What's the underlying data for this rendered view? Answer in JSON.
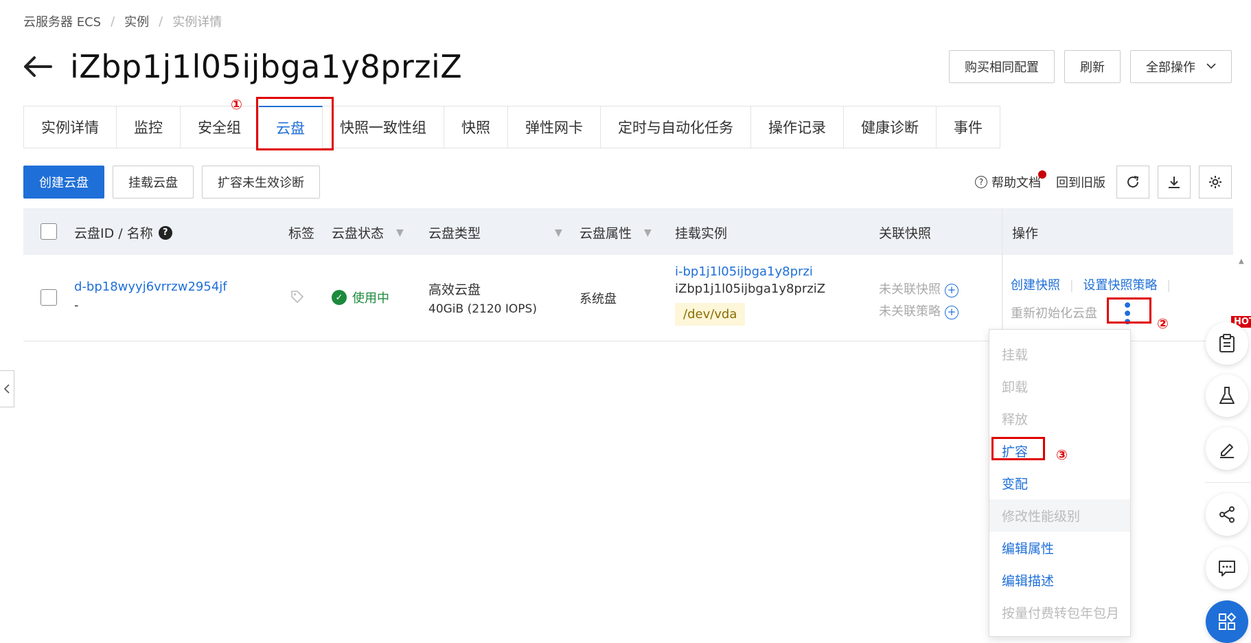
{
  "breadcrumb": {
    "items": [
      "云服务器 ECS",
      "实例",
      "实例详情"
    ],
    "separator": "/"
  },
  "page_title": "iZbp1j1l05ijbga1y8prziZ",
  "header_actions": {
    "buy_same": "购买相同配置",
    "refresh": "刷新",
    "all_ops": "全部操作"
  },
  "tabs": [
    {
      "label": "实例详情"
    },
    {
      "label": "监控"
    },
    {
      "label": "安全组"
    },
    {
      "label": "云盘",
      "active": true
    },
    {
      "label": "快照一致性组"
    },
    {
      "label": "快照"
    },
    {
      "label": "弹性网卡"
    },
    {
      "label": "定时与自动化任务"
    },
    {
      "label": "操作记录"
    },
    {
      "label": "健康诊断"
    },
    {
      "label": "事件"
    }
  ],
  "annotations": {
    "n1": "①",
    "n2": "②",
    "n3": "③"
  },
  "toolbar": {
    "create_disk": "创建云盘",
    "attach_disk": "挂载云盘",
    "resize_diag": "扩容未生效诊断"
  },
  "toolbar_right": {
    "help": "帮助文档",
    "old_version": "回到旧版"
  },
  "table": {
    "headers": {
      "disk_id": "云盘ID / 名称",
      "tags": "标签",
      "status": "云盘状态",
      "type": "云盘类型",
      "attribute": "云盘属性",
      "instance": "挂载实例",
      "snapshot": "关联快照",
      "ops": "操作"
    },
    "rows": [
      {
        "disk_id": "d-bp18wyyj6vrrzw2954jf",
        "disk_name": "-",
        "status": "使用中",
        "type": "高效云盘",
        "type_detail": "40GiB (2120 IOPS)",
        "attribute": "系统盘",
        "instance_id": "i-bp1j1l05ijbga1y8przi",
        "instance_name": "iZbp1j1l05ijbga1y8prziZ",
        "device": "/dev/vda",
        "snapshot": "未关联快照",
        "policy": "未关联策略",
        "op_create_snapshot": "创建快照",
        "op_set_policy": "设置快照策略",
        "op_reinit": "重新初始化云盘"
      }
    ]
  },
  "dropdown": {
    "items": [
      {
        "label": "挂载",
        "enabled": false
      },
      {
        "label": "卸载",
        "enabled": false
      },
      {
        "label": "释放",
        "enabled": false
      },
      {
        "label": "扩容",
        "enabled": true
      },
      {
        "label": "变配",
        "enabled": true
      },
      {
        "label": "修改性能级别",
        "enabled": false
      },
      {
        "label": "编辑属性",
        "enabled": true
      },
      {
        "label": "编辑描述",
        "enabled": true
      },
      {
        "label": "按量付费转包年包月",
        "enabled": false
      }
    ]
  },
  "float_bar": {
    "hot": "HOT"
  },
  "colors": {
    "accent": "#1f6fd8",
    "annotation": "#e00000",
    "success": "#1b8a3c"
  }
}
